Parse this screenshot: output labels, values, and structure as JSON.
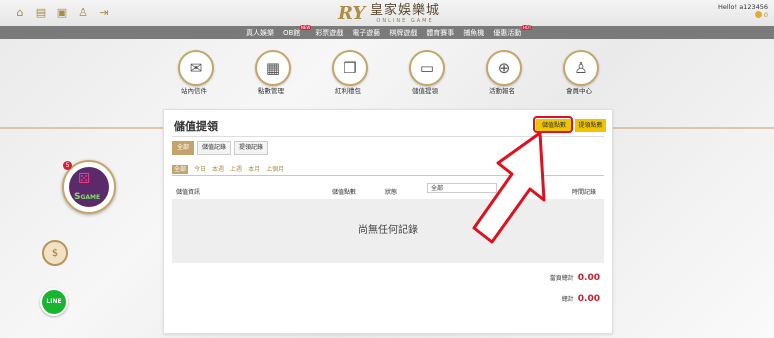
{
  "header": {
    "logo_mark": "RY",
    "logo_cn": "皇家娛樂城",
    "logo_en": "ONLINE GAME",
    "greeting": "Hello! a123456",
    "balance": "0",
    "icons": [
      "home-icon",
      "wallet-icon",
      "gift-icon",
      "user-icon",
      "logout-icon"
    ]
  },
  "nav": {
    "items": [
      {
        "label": "真人娛樂",
        "badge": ""
      },
      {
        "label": "OB館",
        "badge": "NEW"
      },
      {
        "label": "彩票遊戲",
        "badge": ""
      },
      {
        "label": "電子遊藝",
        "badge": ""
      },
      {
        "label": "棋牌遊戲",
        "badge": ""
      },
      {
        "label": "體育賽事",
        "badge": ""
      },
      {
        "label": "捕魚機",
        "badge": ""
      },
      {
        "label": "優惠活動",
        "badge": "HOT"
      }
    ]
  },
  "circles": [
    {
      "label": "站內信件",
      "icon": "mail-icon"
    },
    {
      "label": "點數管理",
      "icon": "wallet-icon"
    },
    {
      "label": "紅利禮包",
      "icon": "gift-icon"
    },
    {
      "label": "儲值提領",
      "icon": "atm-icon"
    },
    {
      "label": "活動報名",
      "icon": "gamepad-icon"
    },
    {
      "label": "會員中心",
      "icon": "user-icon"
    }
  ],
  "panel": {
    "title": "儲值提領",
    "deposit_btn": "儲值點數",
    "withdraw_btn": "提領點數",
    "tabs": [
      "全部",
      "儲值記錄",
      "提領記錄"
    ],
    "dates": [
      "全部",
      "今日",
      "本週",
      "上週",
      "本月",
      "上個月"
    ],
    "columns": {
      "info": "儲值資訊",
      "points": "儲值點數",
      "status": "狀態",
      "select": "全部",
      "time": "時間記錄"
    },
    "empty": "尚無任何記錄",
    "total1_label": "當頁總計",
    "total1_value": "0.00",
    "total2_label": "總計",
    "total2_value": "0.00"
  },
  "side": {
    "sgame_badge": "5",
    "sgame_text": "GAME",
    "sgame_letter": "S",
    "line": "LINE"
  },
  "colors": {
    "gold": "#c6a56a",
    "accent_yellow": "#f0c400",
    "red": "#e0101f",
    "line_green": "#19b531",
    "nav_gray": "#7a7a7a"
  }
}
